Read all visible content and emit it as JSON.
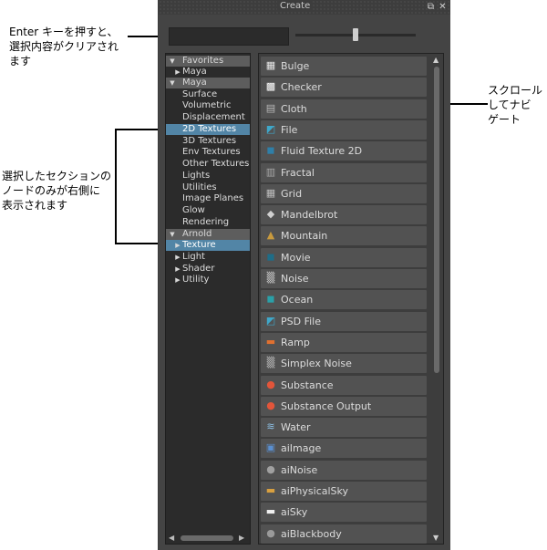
{
  "annotations": {
    "top_left": "Enter キーを押すと、\n選択内容がクリアされ\nます",
    "middle_left": "選択したセクションの\nノードのみが右側に\n表示されます",
    "right": "スクロール\nしてナビ\nゲート"
  },
  "window": {
    "title": "Create",
    "float_button": "⧉",
    "close_button": "✕"
  },
  "search": {
    "value": "",
    "placeholder": ""
  },
  "icon_size_slider": {
    "value": 0.52
  },
  "tree": [
    {
      "label": "Favorites",
      "type": "header",
      "arrow": "down"
    },
    {
      "label": "Maya",
      "type": "sub",
      "arrow": "right"
    },
    {
      "label": "Maya",
      "type": "header",
      "arrow": "down"
    },
    {
      "label": "Surface",
      "type": "child"
    },
    {
      "label": "Volumetric",
      "type": "child"
    },
    {
      "label": "Displacement",
      "type": "child"
    },
    {
      "label": "2D Textures",
      "type": "child",
      "selected": true
    },
    {
      "label": "3D Textures",
      "type": "child"
    },
    {
      "label": "Env Textures",
      "type": "child"
    },
    {
      "label": "Other Textures",
      "type": "child"
    },
    {
      "label": "Lights",
      "type": "child"
    },
    {
      "label": "Utilities",
      "type": "child"
    },
    {
      "label": "Image Planes",
      "type": "child"
    },
    {
      "label": "Glow",
      "type": "child"
    },
    {
      "label": "Rendering",
      "type": "child"
    },
    {
      "label": "Arnold",
      "type": "header",
      "arrow": "down"
    },
    {
      "label": "Texture",
      "type": "sub",
      "arrow": "right",
      "selected": true
    },
    {
      "label": "Light",
      "type": "sub",
      "arrow": "right"
    },
    {
      "label": "Shader",
      "type": "sub",
      "arrow": "right"
    },
    {
      "label": "Utility",
      "type": "sub",
      "arrow": "right"
    }
  ],
  "nodes": [
    {
      "label": "Bulge",
      "icon": "bulge-icon",
      "glyph": "▦",
      "color": "#e8e8e8"
    },
    {
      "label": "Checker",
      "icon": "checker-icon",
      "glyph": "▩",
      "color": "#ffffff"
    },
    {
      "label": "Cloth",
      "icon": "cloth-icon",
      "glyph": "▤",
      "color": "#b8b8b8"
    },
    {
      "label": "File",
      "icon": "file-icon",
      "glyph": "◩",
      "color": "#3fa7c9"
    },
    {
      "label": "Fluid Texture 2D",
      "icon": "fluid-texture-icon",
      "glyph": "◼",
      "color": "#2f7fa8"
    },
    {
      "label": "Fractal",
      "icon": "fractal-icon",
      "glyph": "▥",
      "color": "#a8a8a8"
    },
    {
      "label": "Grid",
      "icon": "grid-icon",
      "glyph": "▦",
      "color": "#bdbdbd"
    },
    {
      "label": "Mandelbrot",
      "icon": "mandelbrot-icon",
      "glyph": "◆",
      "color": "#d0d0d0"
    },
    {
      "label": "Mountain",
      "icon": "mountain-icon",
      "glyph": "▲",
      "color": "#c89a3e"
    },
    {
      "label": "Movie",
      "icon": "movie-icon",
      "glyph": "◼",
      "color": "#1e6d88"
    },
    {
      "label": "Noise",
      "icon": "noise-icon",
      "glyph": "▒",
      "color": "#cfcfcf"
    },
    {
      "label": "Ocean",
      "icon": "ocean-icon",
      "glyph": "◼",
      "color": "#2aa0a8"
    },
    {
      "label": "PSD File",
      "icon": "psd-file-icon",
      "glyph": "◩",
      "color": "#3fa7c9"
    },
    {
      "label": "Ramp",
      "icon": "ramp-icon",
      "glyph": "▬",
      "color": "#e07030"
    },
    {
      "label": "Simplex Noise",
      "icon": "simplex-noise-icon",
      "glyph": "▒",
      "color": "#bdbdbd"
    },
    {
      "label": "Substance",
      "icon": "substance-icon",
      "glyph": "●",
      "color": "#e2553a"
    },
    {
      "label": "Substance Output",
      "icon": "substance-output-icon",
      "glyph": "●",
      "color": "#e2553a"
    },
    {
      "label": "Water",
      "icon": "water-icon",
      "glyph": "≋",
      "color": "#8fc3e8"
    },
    {
      "label": "aiImage",
      "icon": "ai-image-icon",
      "glyph": "▣",
      "color": "#5a8fd0"
    },
    {
      "label": "aiNoise",
      "icon": "ai-noise-icon",
      "glyph": "●",
      "color": "#a0a0a0"
    },
    {
      "label": "aiPhysicalSky",
      "icon": "ai-physical-sky-icon",
      "glyph": "▬",
      "color": "#d8a040"
    },
    {
      "label": "aiSky",
      "icon": "ai-sky-icon",
      "glyph": "▬",
      "color": "#f0f0f0"
    },
    {
      "label": "aiBlackbody",
      "icon": "ai-blackbody-icon",
      "glyph": "●",
      "color": "#9a9a9a"
    }
  ]
}
